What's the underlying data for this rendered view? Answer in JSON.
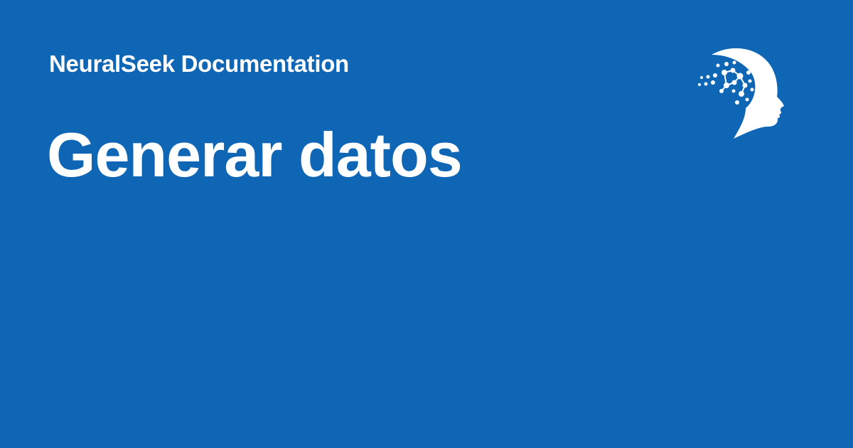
{
  "header": {
    "site_name": "NeuralSeek Documentation"
  },
  "main": {
    "title": "Generar datos"
  },
  "logo": {
    "icon": "head-network-icon"
  },
  "colors": {
    "background": "#0f66b5",
    "foreground": "#ffffff"
  }
}
